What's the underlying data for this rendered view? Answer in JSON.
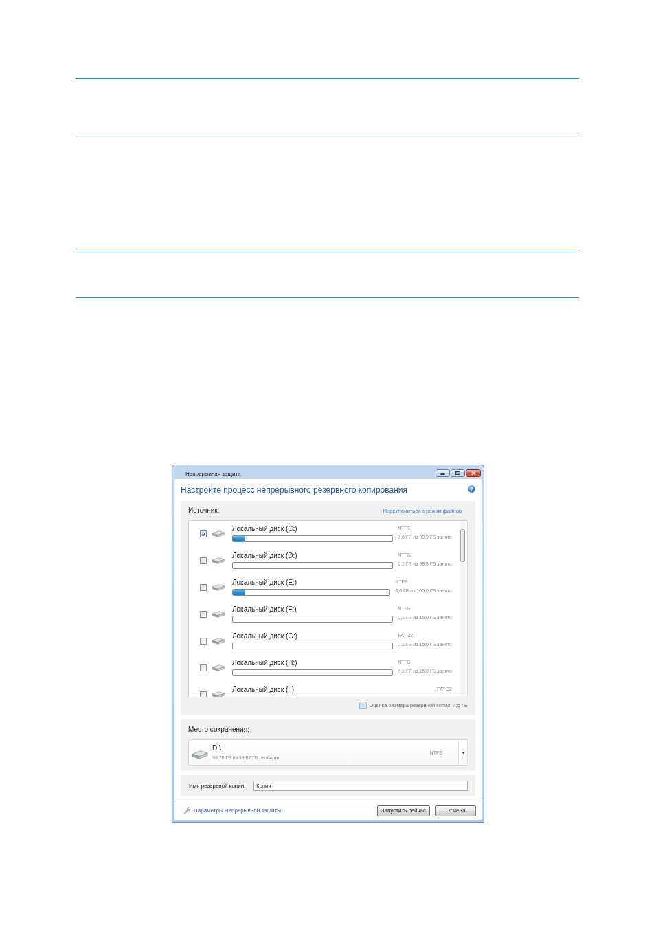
{
  "window": {
    "title": "Непрерывная защита"
  },
  "heading": "Настройте процесс непрерывного резервного копирования",
  "source": {
    "label": "Источник:",
    "switch_link": "Переключиться в режим файлов",
    "disks": [
      {
        "name": "Локальный диск (C:)",
        "checked": true,
        "level": 0.076,
        "file_system": "NTFS",
        "usage": "7,6 ГБ из 99,9 ГБ занято"
      },
      {
        "name": "Локальный диск (D:)",
        "checked": false,
        "file_system": "NTFS",
        "usage": "0,1 ГБ из 99,9 ГБ занято"
      },
      {
        "name": "Локальный диск (E:)",
        "checked": false,
        "level": 0.08,
        "file_system": "NTFS",
        "usage": "8,0 ГБ из 100,0 ГБ занято"
      },
      {
        "name": "Локальный диск (F:)",
        "checked": false,
        "file_system": "NTFS",
        "usage": "0,1 ГБ из 15,0 ГБ занято"
      },
      {
        "name": "Локальный диск (G:)",
        "checked": false,
        "file_system": "FAT 32",
        "usage": "0,1 ГБ из 15,0 ГБ занято"
      },
      {
        "name": "Локальный диск (H:)",
        "checked": false,
        "file_system": "NTFS",
        "usage": "0,1 ГБ из 15,0 ГБ занято"
      },
      {
        "name": "Локальный диск (I:)",
        "checked": false,
        "file_system": "FAT 32"
      }
    ],
    "estimate": "Оценка размера резервной копии: 4,5 ГБ"
  },
  "destination": {
    "label": "Место сохранения:",
    "drive": "D:\\",
    "free": "99,78 ГБ из 99,87 ГБ свободно",
    "file_system": "NTFS"
  },
  "backup_name": {
    "label": "Имя резервной копии:",
    "value": "Копия"
  },
  "footer": {
    "settings_link": "Параметры Непрерывной защиты",
    "buttons": [
      "Запустить сейчас",
      "Отмена"
    ]
  }
}
